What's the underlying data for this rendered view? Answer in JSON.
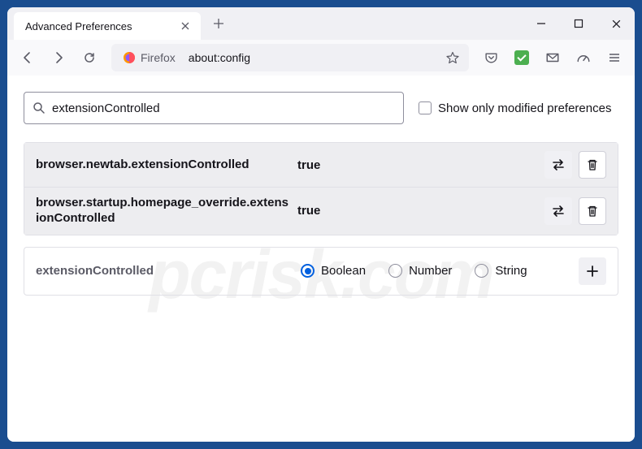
{
  "tab": {
    "title": "Advanced Preferences"
  },
  "urlbar": {
    "identity": "Firefox",
    "url": "about:config"
  },
  "search": {
    "value": "extensionControlled",
    "show_modified_label": "Show only modified preferences"
  },
  "prefs": [
    {
      "name": "browser.newtab.extensionControlled",
      "value": "true"
    },
    {
      "name": "browser.startup.homepage_override.extensionControlled",
      "value": "true"
    }
  ],
  "add": {
    "name": "extensionControlled",
    "types": [
      "Boolean",
      "Number",
      "String"
    ],
    "selected": "Boolean"
  },
  "watermark": "pcrisk.com"
}
